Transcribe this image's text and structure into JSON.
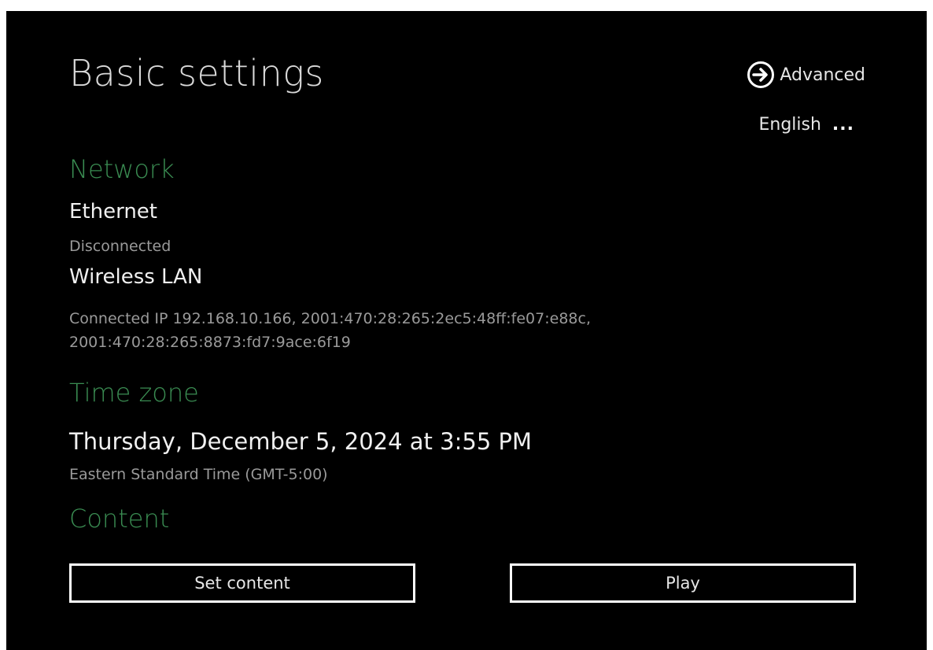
{
  "page": {
    "title": "Basic settings"
  },
  "header": {
    "advanced_label": "Advanced",
    "advanced_icon": "arrow-circle-right-icon",
    "language_label": "English",
    "language_more": "..."
  },
  "network": {
    "heading": "Network",
    "ethernet": {
      "name": "Ethernet",
      "status": "Disconnected"
    },
    "wireless": {
      "name": "Wireless LAN",
      "status_line1": "Connected IP 192.168.10.166, 2001:470:28:265:2ec5:48ff:fe07:e88c,",
      "status_line2": "2001:470:28:265:8873:fd7:9ace:6f19"
    }
  },
  "timezone": {
    "heading": "Time zone",
    "datetime": "Thursday, December 5, 2024 at 3:55 PM",
    "zone": "Eastern Standard Time (GMT-5:00)"
  },
  "content": {
    "heading": "Content",
    "set_content_label": "Set content",
    "play_label": "Play"
  },
  "colors": {
    "background": "#000000",
    "heading_accent": "#3a8c52",
    "text_primary": "#f0f0f0",
    "text_secondary": "#9a9a9a"
  }
}
